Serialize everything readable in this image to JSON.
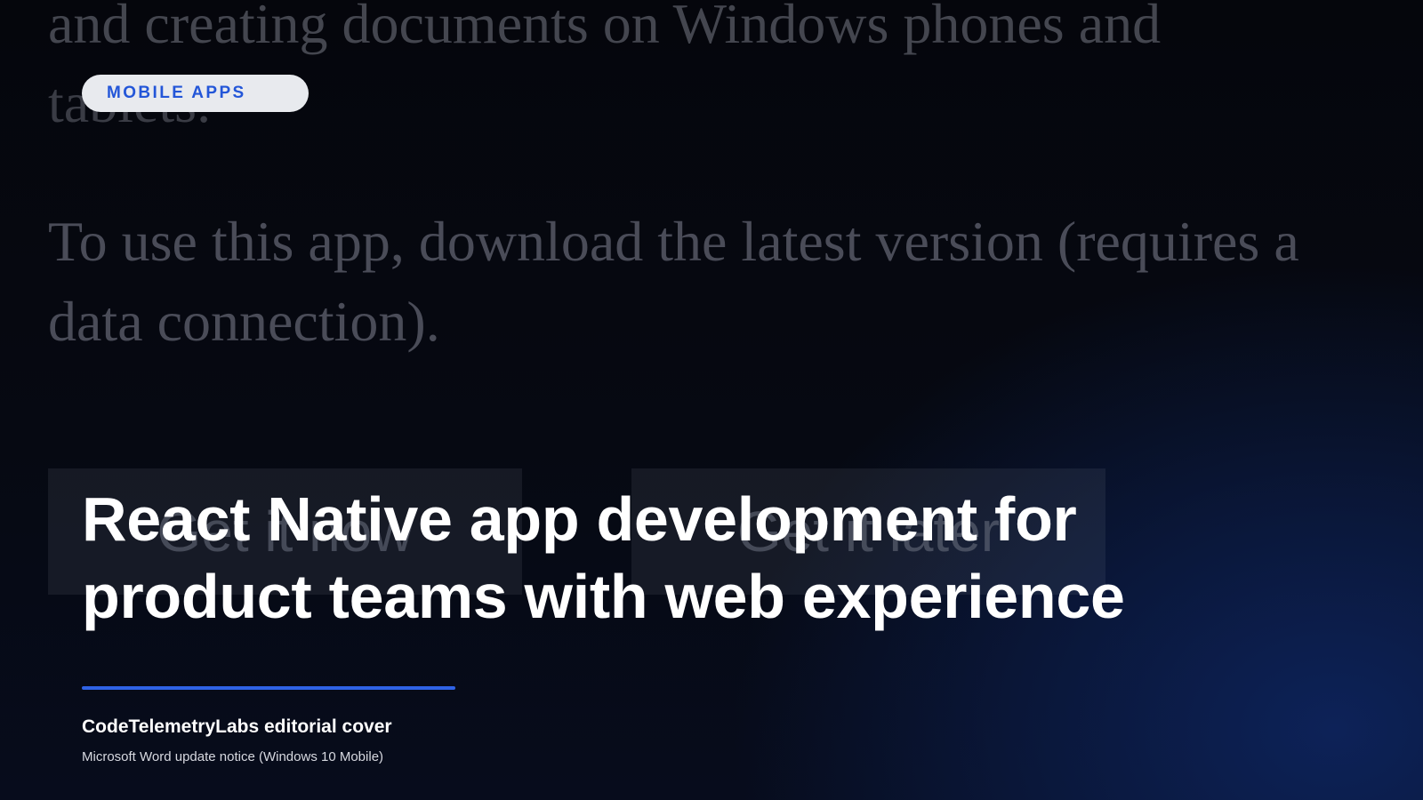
{
  "background_screenshot": {
    "lines": [
      "and creating documents on Windows phones and",
      "tablets.",
      "To use this app, download the latest version (requires a",
      "data connection)."
    ],
    "buttons": {
      "primary": "Get it now",
      "secondary": "Get it later"
    }
  },
  "cover": {
    "category": "MOBILE APPS",
    "headline_line1": "React Native app development for",
    "headline_line2": "product teams with web experience",
    "byline": "CodeTelemetryLabs editorial cover",
    "caption": "Microsoft Word update notice (Windows 10 Mobile)"
  },
  "colors": {
    "accent": "#2f63e6",
    "badge_text": "#2356d8",
    "badge_bg": "#e8eaee",
    "background": "#05070f"
  }
}
